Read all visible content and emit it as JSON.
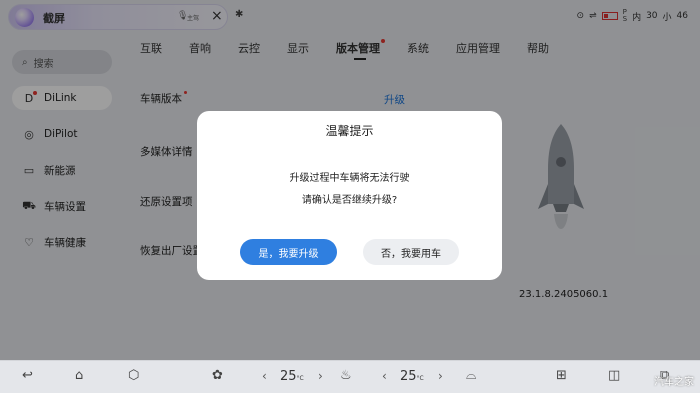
{
  "voice_bar": {
    "title": "截屏",
    "driver_label": "主驾"
  },
  "status": {
    "time_text": "PM",
    "ps_text": "P\nS",
    "day_label": "内",
    "temp_val": "30",
    "unit": "小",
    "num": "46"
  },
  "tabs": [
    {
      "label": "互联",
      "active": false
    },
    {
      "label": "音响",
      "active": false
    },
    {
      "label": "云控",
      "active": false
    },
    {
      "label": "显示",
      "active": false
    },
    {
      "label": "版本管理",
      "active": true,
      "badge": true
    },
    {
      "label": "系统",
      "active": false
    },
    {
      "label": "应用管理",
      "active": false
    },
    {
      "label": "帮助",
      "active": false
    }
  ],
  "sidebar": {
    "search_label": "搜索",
    "items": [
      {
        "label": "DiLink",
        "active": true,
        "icon": "dilink-icon"
      },
      {
        "label": "DiPilot",
        "active": false,
        "icon": "dipilot-icon"
      },
      {
        "label": "新能源",
        "active": false,
        "icon": "battery-icon"
      },
      {
        "label": "车辆设置",
        "active": false,
        "icon": "car-icon"
      },
      {
        "label": "车辆健康",
        "active": false,
        "icon": "heart-icon"
      }
    ]
  },
  "content": {
    "row1": "车辆版本",
    "row2": "多媒体详情",
    "row3": "还原设置项",
    "row4": "恢复出厂设置",
    "upgrade_link": "升级",
    "version": "23.1.8.2405060.1"
  },
  "dialog": {
    "title": "温馨提示",
    "line1": "升级过程中车辆将无法行驶",
    "line2": "请确认是否继续升级?",
    "confirm": "是，我要升级",
    "cancel": "否，我要用车"
  },
  "dock": {
    "temp_left": "25",
    "temp_right": "25",
    "unit": "°C"
  },
  "watermark": "汽车之家",
  "colors": {
    "accent": "#2f7fe0",
    "badge": "#e53935",
    "link": "#1a73d9"
  }
}
